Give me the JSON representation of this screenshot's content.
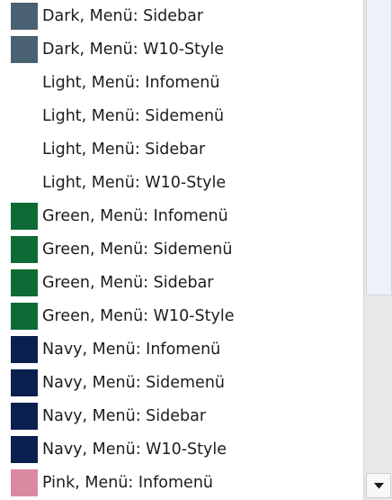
{
  "list": {
    "items": [
      {
        "label": "Dark, Menü: Sidebar",
        "swatch": "#4a6172"
      },
      {
        "label": "Dark, Menü: W10-Style",
        "swatch": "#4a6172"
      },
      {
        "label": "Light, Menü: Infomenü",
        "swatch": ""
      },
      {
        "label": "Light, Menü: Sidemenü",
        "swatch": ""
      },
      {
        "label": "Light, Menü: Sidebar",
        "swatch": ""
      },
      {
        "label": "Light, Menü: W10-Style",
        "swatch": ""
      },
      {
        "label": "Green, Menü: Infomenü",
        "swatch": "#0e6b35"
      },
      {
        "label": "Green, Menü: Sidemenü",
        "swatch": "#0e6b35"
      },
      {
        "label": "Green, Menü: Sidebar",
        "swatch": "#0e6b35"
      },
      {
        "label": "Green, Menü: W10-Style",
        "swatch": "#0e6b35"
      },
      {
        "label": "Navy, Menü: Infomenü",
        "swatch": "#0b1f4f"
      },
      {
        "label": "Navy, Menü: Sidemenü",
        "swatch": "#0b1f4f"
      },
      {
        "label": "Navy, Menü: Sidebar",
        "swatch": "#0b1f4f"
      },
      {
        "label": "Navy, Menü: W10-Style",
        "swatch": "#0b1f4f"
      },
      {
        "label": "Pink, Menü: Infomenü",
        "swatch": "#d98aa0"
      }
    ]
  },
  "scrollbar": {
    "down_arrow_icon": "chevron-down-icon"
  }
}
